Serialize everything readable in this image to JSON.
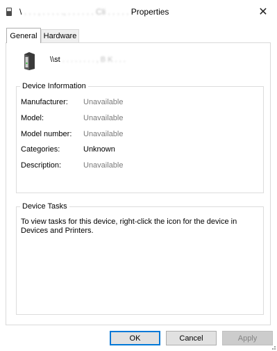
{
  "window": {
    "title_prefix": "\\",
    "title_obscured": ". . . , . . . . ., . . . . . . Cli . . . . .",
    "title_suffix": "Properties",
    "close_glyph": "✕"
  },
  "tabs": [
    {
      "label": "General",
      "active": true
    },
    {
      "label": "Hardware",
      "active": false
    }
  ],
  "device": {
    "name_prefix": "\\\\st",
    "name_obscured": ". . . . . . . . , B K . . ."
  },
  "device_information": {
    "title": "Device Information",
    "rows": [
      {
        "label": "Manufacturer:",
        "value": "Unavailable"
      },
      {
        "label": "Model:",
        "value": "Unavailable"
      },
      {
        "label": "Model number:",
        "value": "Unavailable"
      },
      {
        "label": "Categories:",
        "value": "Unknown"
      },
      {
        "label": "Description:",
        "value": "Unavailable"
      }
    ]
  },
  "device_tasks": {
    "title": "Device Tasks",
    "text": "To view tasks for this device, right-click the icon for the device in Devices and Printers."
  },
  "buttons": {
    "ok": "OK",
    "cancel": "Cancel",
    "apply": "Apply"
  },
  "colors": {
    "accent": "#0078d7",
    "muted_value": "#7a7a7a"
  }
}
